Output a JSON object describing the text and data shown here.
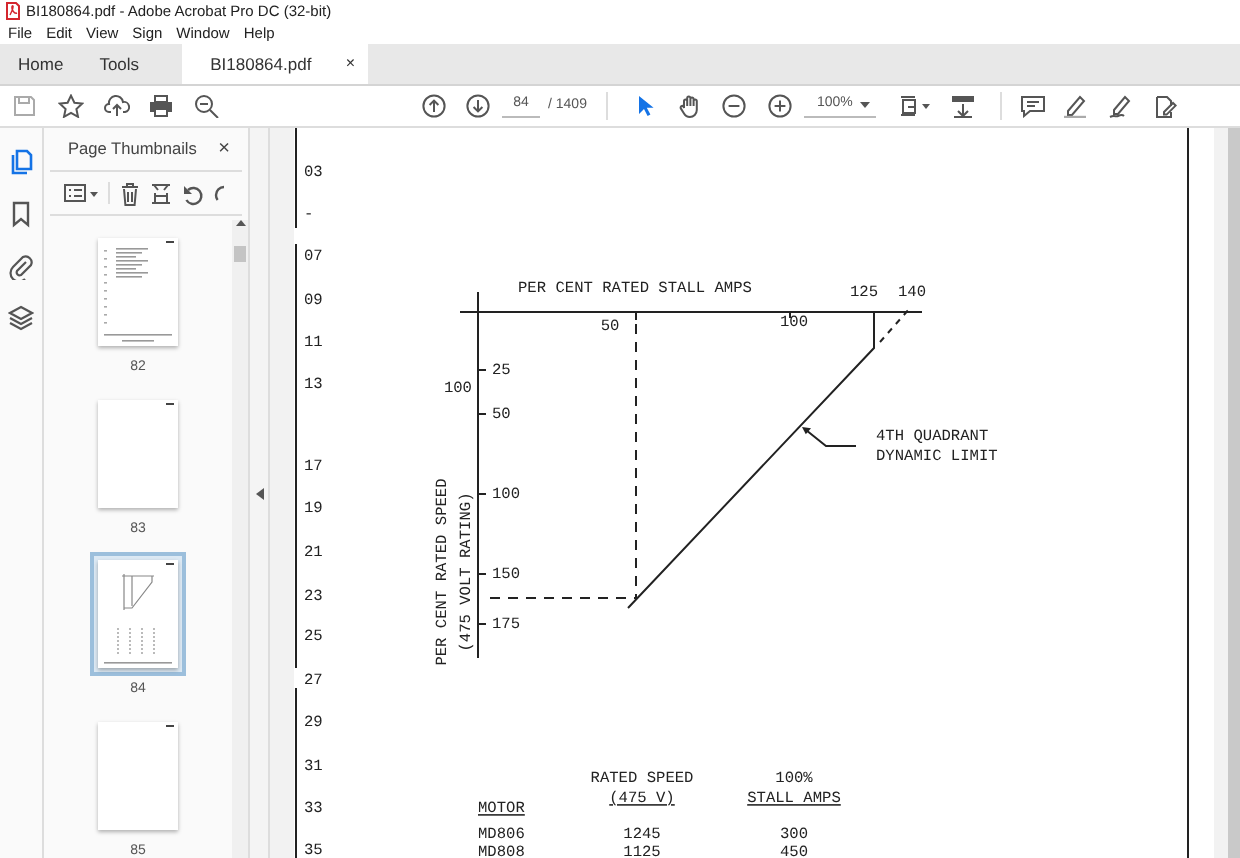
{
  "window": {
    "title": "BI180864.pdf - Adobe Acrobat Pro DC (32-bit)"
  },
  "menu": [
    "File",
    "Edit",
    "View",
    "Sign",
    "Window",
    "Help"
  ],
  "tabs": [
    {
      "label": "Home",
      "selected": false,
      "kind": "nav"
    },
    {
      "label": "Tools",
      "selected": false,
      "kind": "nav"
    },
    {
      "label": "BI180864.pdf",
      "selected": true,
      "kind": "document",
      "close": "×"
    }
  ],
  "toolbar": {
    "page": "84",
    "page_total": "/ 1409",
    "zoom": "100%"
  },
  "side_rail": [
    {
      "kind": "pages",
      "selected": true
    },
    {
      "kind": "bookmarks",
      "selected": false
    },
    {
      "kind": "attachments",
      "selected": false
    },
    {
      "kind": "layers",
      "selected": false
    }
  ],
  "thumbnails_panel": {
    "title": "Page Thumbnails",
    "close": "×",
    "pages": [
      {
        "label": "82",
        "kind": "text",
        "selected": false
      },
      {
        "label": "83",
        "kind": "blank",
        "selected": false
      },
      {
        "label": "84",
        "kind": "diagram",
        "selected": true
      },
      {
        "label": "85",
        "kind": "blank",
        "selected": false
      }
    ]
  },
  "document": {
    "line_numbers": [
      "03",
      "-",
      "07",
      "09",
      "11",
      "13",
      "17",
      "19",
      "21",
      "23",
      "25",
      "27",
      "29",
      "31",
      "33",
      "35"
    ],
    "diagram": {
      "x_axis_title": "PER CENT RATED STALL AMPS",
      "x_labels": [
        "50",
        "100",
        "125",
        "140"
      ],
      "y_labels": [
        "25",
        "50",
        "100",
        "150",
        "175"
      ],
      "y_side_label": "100",
      "y_axis_title": [
        "PER CENT RATED SPEED",
        "(475 VOLT RATING)"
      ],
      "annotation": [
        "4TH QUADRANT",
        "DYNAMIC LIMIT"
      ]
    },
    "table": {
      "columns": [
        {
          "heading": [
            "MOTOR"
          ]
        },
        {
          "heading": [
            "RATED SPEED",
            "(475 V)"
          ]
        },
        {
          "heading": [
            "100%",
            "STALL AMPS"
          ]
        }
      ],
      "rows": [
        [
          "MD806",
          "1245",
          "300"
        ],
        [
          "MD808",
          "1125",
          "450"
        ]
      ]
    }
  }
}
